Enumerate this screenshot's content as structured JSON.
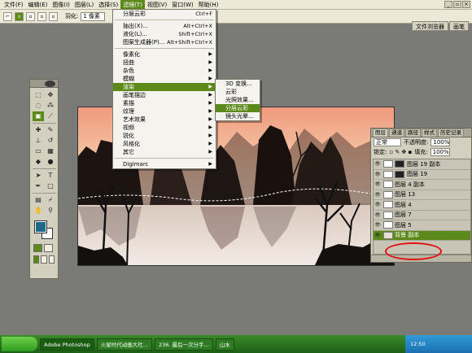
{
  "menubar": {
    "items": [
      "文件(F)",
      "编辑(E)",
      "图像(I)",
      "图层(L)",
      "选择(S)",
      "滤镜(T)",
      "视图(V)",
      "窗口(W)",
      "帮助(H)"
    ]
  },
  "options": {
    "feather_label": "羽化:",
    "feather_value": "1 像素",
    "palette_tabs": [
      "文件浏览器",
      "画笔"
    ]
  },
  "filter_menu": {
    "last_filter": "分层云彩",
    "last_filter_shortcut": "Ctrl+F",
    "extract": "抽出(X)...",
    "extract_shortcut": "Alt+Ctrl+X",
    "liquify": "液化(L)...",
    "liquify_shortcut": "Shift+Ctrl+X",
    "pattern_maker": "图案生成器(P)...",
    "pattern_maker_shortcut": "Alt+Shift+Ctrl+X",
    "groups": [
      "像素化",
      "扭曲",
      "杂色",
      "模糊",
      "渲染",
      "画笔描边",
      "素描",
      "纹理",
      "艺术效果",
      "视频",
      "锐化",
      "风格化",
      "其它"
    ],
    "extra": "Digimarc"
  },
  "render_menu": {
    "items": [
      "3D 变换...",
      "云彩",
      "光照效果...",
      "分层云彩",
      "镜头光晕..."
    ]
  },
  "layers_panel": {
    "tabs": [
      "图层",
      "通道",
      "路径",
      "样式",
      "历史记录"
    ],
    "blend_mode": "正常",
    "opacity_label": "不透明度:",
    "opacity": "100%",
    "lock_label": "锁定:",
    "fill_label": "填充:",
    "fill": "100%",
    "layers": [
      {
        "name": "图层 19 副本"
      },
      {
        "name": "图层 19"
      },
      {
        "name": "图层 4 副本"
      },
      {
        "name": "图层 13"
      },
      {
        "name": "图层 4"
      },
      {
        "name": "图层 7"
      },
      {
        "name": "图层 5"
      },
      {
        "name": "背景 副本"
      }
    ]
  },
  "taskbar": {
    "tasks": [
      "Adobe Photoshop",
      "火星时代动画大社...",
      "236. 最后一次分手...",
      "山水"
    ],
    "tray_time": "12:50"
  },
  "colors": {
    "accent": "#5b8a1a",
    "foreground_swatch": "#1f6a8a",
    "highlight_ring": "#e01010"
  }
}
